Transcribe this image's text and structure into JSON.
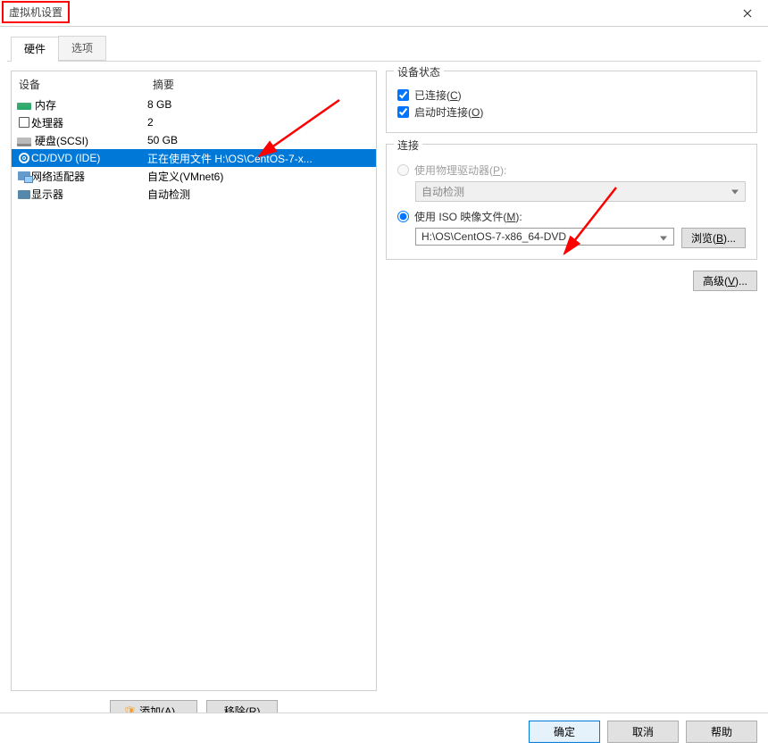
{
  "window": {
    "title": "虚拟机设置"
  },
  "tabs": {
    "hardware": "硬件",
    "options": "选项"
  },
  "deviceList": {
    "headers": {
      "device": "设备",
      "summary": "摘要"
    },
    "items": [
      {
        "name": "内存",
        "summary": "8 GB",
        "iconClass": "ico-mem"
      },
      {
        "name": "处理器",
        "summary": "2",
        "iconClass": "ico-cpu"
      },
      {
        "name": "硬盘(SCSI)",
        "summary": "50 GB",
        "iconClass": "ico-hdd"
      },
      {
        "name": "CD/DVD (IDE)",
        "summary": "正在使用文件 H:\\OS\\CentOS-7-x...",
        "iconClass": "ico-cd",
        "selected": true
      },
      {
        "name": "网络适配器",
        "summary": "自定义(VMnet6)",
        "iconClass": "ico-net"
      },
      {
        "name": "显示器",
        "summary": "自动检测",
        "iconClass": "ico-disp"
      }
    ]
  },
  "leftButtons": {
    "add": "添加(",
    "addKey": "A",
    "addSuffix": ")...",
    "remove": "移除(",
    "removeKey": "R",
    "removeSuffix": ")"
  },
  "rightPanel": {
    "statusGroup": "设备状态",
    "connected": "已连接(",
    "connectedKey": "C",
    "connectedSuffix": ")",
    "connectAtPower": "启动时连接(",
    "connectAtPowerKey": "O",
    "connectAtPowerSuffix": ")",
    "connGroup": "连接",
    "physical": "使用物理驱动器(",
    "physicalKey": "P",
    "physicalSuffix": "):",
    "autoDetect": "自动检测",
    "useIso": "使用 ISO 映像文件(",
    "useIsoKey": "M",
    "useIsoSuffix": "):",
    "isoPath": "H:\\OS\\CentOS-7-x86_64-DVD",
    "browse": "浏览(",
    "browseKey": "B",
    "browseSuffix": ")...",
    "advanced": "高级(",
    "advancedKey": "V",
    "advancedSuffix": ")..."
  },
  "footer": {
    "ok": "确定",
    "cancel": "取消",
    "help": "帮助"
  }
}
